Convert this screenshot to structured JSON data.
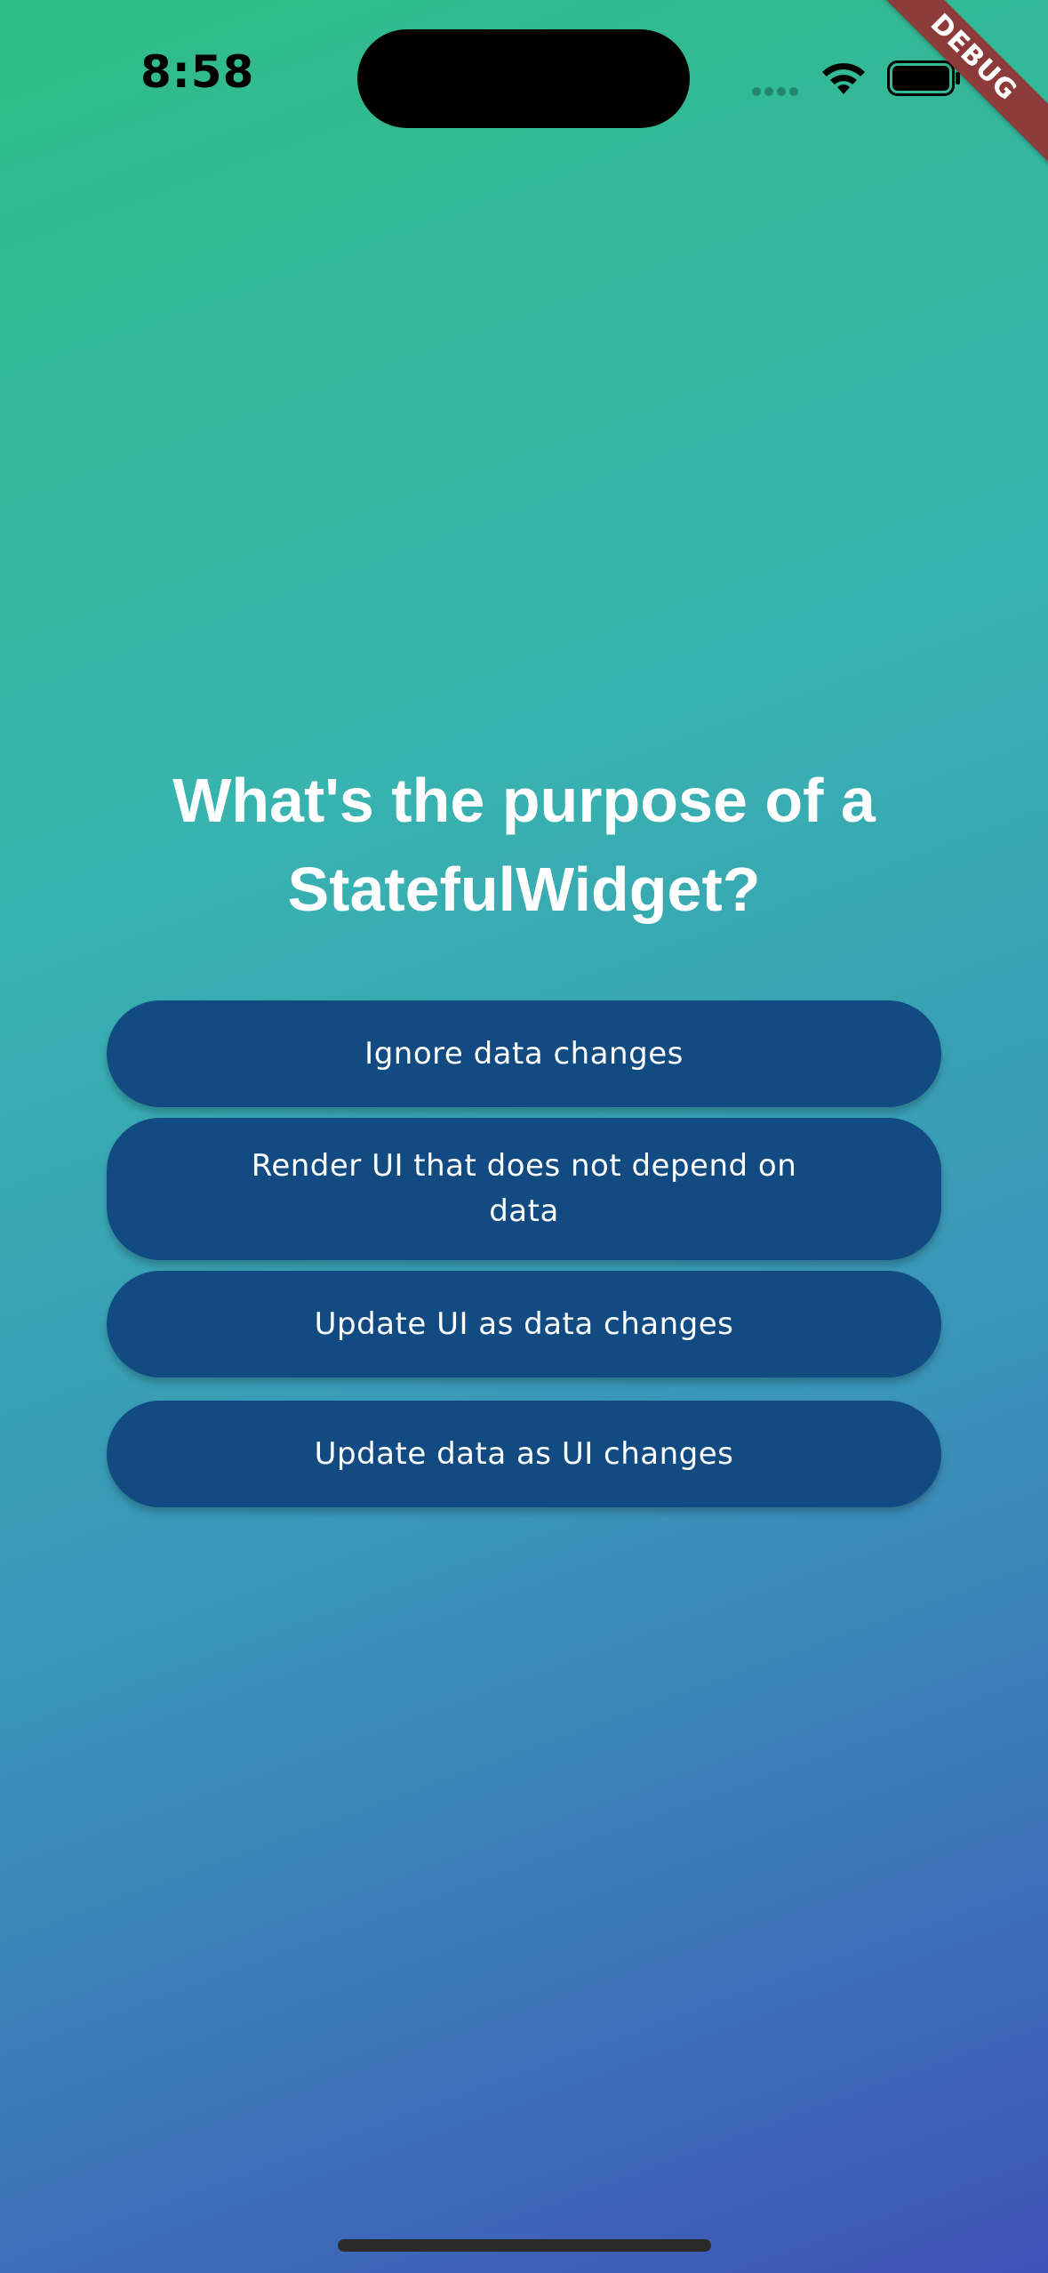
{
  "status_bar": {
    "time": "8:58",
    "signal_icon": "cellular-signal-icon",
    "wifi_icon": "wifi-icon",
    "battery_icon": "battery-icon"
  },
  "debug_banner": {
    "label": "DEBUG",
    "color": "#8c3a3a"
  },
  "quiz": {
    "question": "What's the purpose of a StatefulWidget?",
    "answers": [
      {
        "label": "Ignore data changes"
      },
      {
        "label": "Render UI that does not depend on data"
      },
      {
        "label": "Update UI as data changes"
      },
      {
        "label": "Update data as UI changes"
      }
    ]
  },
  "colors": {
    "button_bg": "#124b82",
    "gradient_start": "#2fbd86",
    "gradient_end": "#3f52b6"
  }
}
